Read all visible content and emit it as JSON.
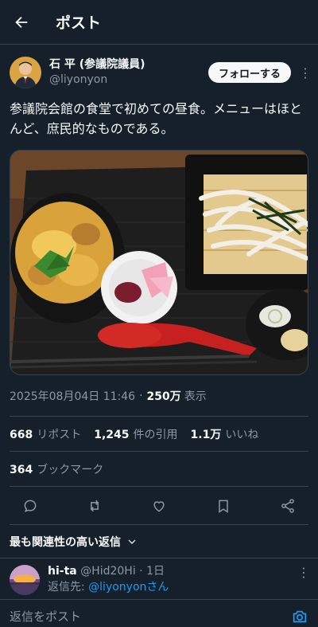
{
  "header": {
    "title": "ポスト"
  },
  "author": {
    "display_name": "石 平 (参議院議員)",
    "handle": "@liyonyon"
  },
  "follow_label": "フォローする",
  "more_glyph": "⋮",
  "tweet": {
    "text": "参議院会館の食堂で初めての昼食。メニューはほとんど、庶民的なものである。"
  },
  "meta": {
    "datetime": "2025年08月04日 11:46",
    "separator": "·",
    "views": "250万",
    "views_label": "表示"
  },
  "stats": {
    "reposts": "668",
    "reposts_label": "リポスト",
    "quotes": "1,245",
    "quotes_label": "件の引用",
    "likes": "1.1万",
    "likes_label": "いいね",
    "bookmarks": "364",
    "bookmarks_label": "ブックマーク"
  },
  "replies_sort": {
    "label": "最も関連性の高い返信"
  },
  "reply": {
    "name": "hi-ta",
    "handle": "@Hid20Hi",
    "sep": "·",
    "time": "1日",
    "to_label": "返信先:",
    "to_handle": "@liyonyonさん"
  },
  "composer": {
    "placeholder": "返信をポスト"
  },
  "icons": [
    "back-arrow-icon",
    "more-icon",
    "reply-icon",
    "repost-icon",
    "like-icon",
    "bookmark-icon",
    "share-icon",
    "chevron-down-icon",
    "camera-icon"
  ],
  "colors": {
    "background": "#15202b",
    "accent": "#1d9bf0",
    "muted": "#8b98a5",
    "divider": "#38444d"
  }
}
